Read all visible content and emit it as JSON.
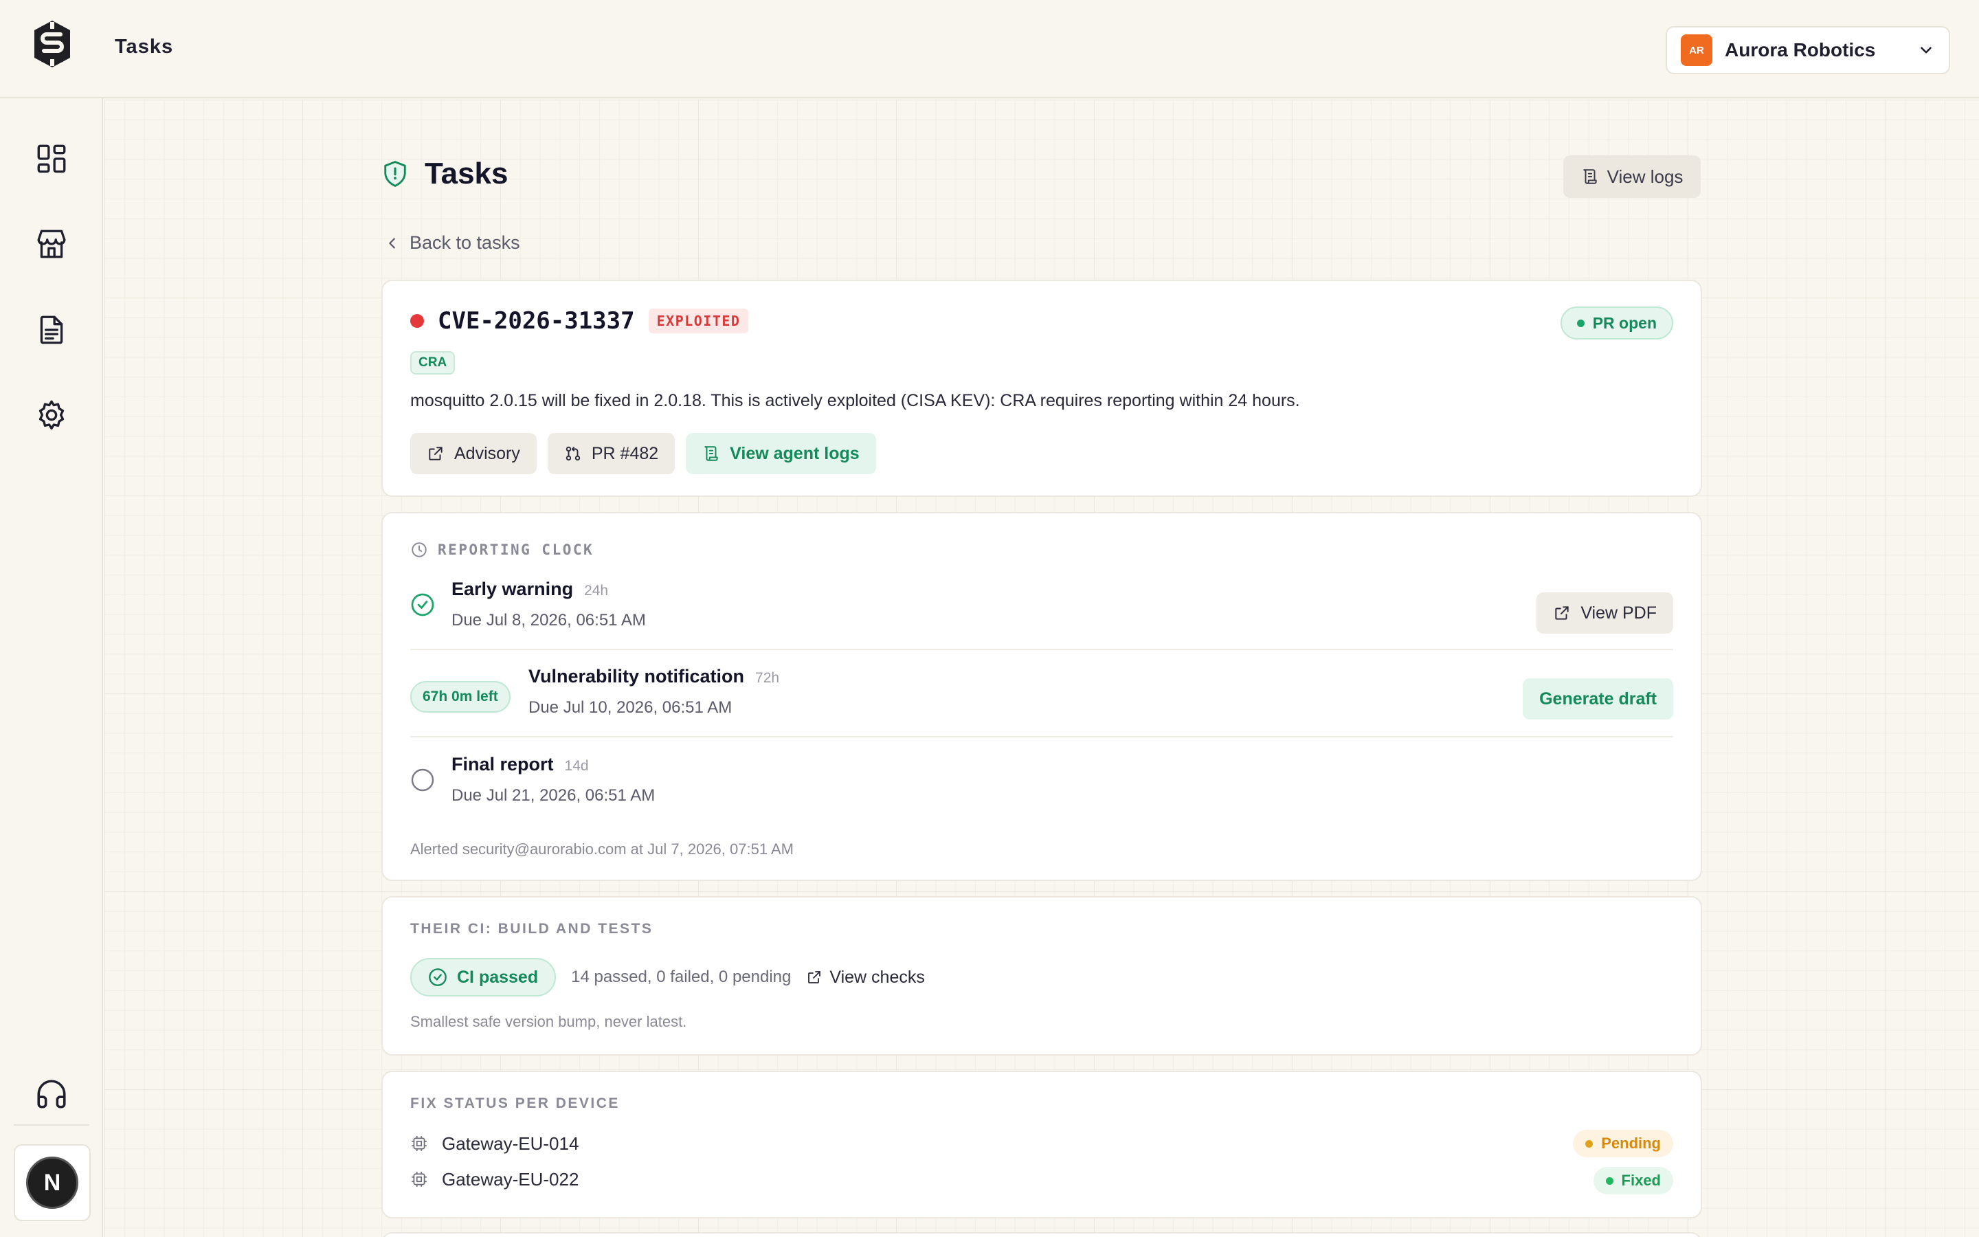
{
  "header": {
    "title": "Tasks",
    "org": {
      "initials": "AR",
      "name": "Aurora Robotics"
    }
  },
  "sidebar": {
    "items": [
      {
        "icon": "dashboard-icon"
      },
      {
        "icon": "store-icon"
      },
      {
        "icon": "document-icon"
      },
      {
        "icon": "gear-icon"
      }
    ],
    "support_icon": "headphones-icon",
    "user_initial": "N"
  },
  "page": {
    "title": "Tasks",
    "view_logs_label": "View logs",
    "back_label": "Back to tasks"
  },
  "vuln": {
    "id": "CVE-2026-31337",
    "exploited_badge": "EXPLOITED",
    "status": "PR open",
    "tag": "CRA",
    "description": "mosquitto 2.0.15 will be fixed in 2.0.18. This is actively exploited (CISA KEV): CRA requires reporting within 24 hours.",
    "actions": {
      "advisory": "Advisory",
      "pr": "PR #482",
      "agent_logs": "View agent logs"
    }
  },
  "reporting": {
    "label": "REPORTING CLOCK",
    "steps": [
      {
        "title": "Early warning",
        "hours": "24h",
        "due": "Due Jul 8, 2026, 06:51 AM",
        "action": "View PDF"
      },
      {
        "title": "Vulnerability notification",
        "hours": "72h",
        "due": "Due Jul 10, 2026, 06:51 AM",
        "time_left": "67h 0m left",
        "action": "Generate draft"
      },
      {
        "title": "Final report",
        "hours": "14d",
        "due": "Due Jul 21, 2026, 06:51 AM"
      }
    ],
    "alert_note": "Alerted security@aurorabio.com at Jul 7, 2026, 07:51 AM"
  },
  "ci": {
    "label": "THEIR CI: BUILD AND TESTS",
    "status": "CI passed",
    "counts": "14 passed, 0 failed, 0 pending",
    "view_checks": "View checks",
    "note": "Smallest safe version bump, never latest."
  },
  "devices": {
    "label": "FIX STATUS PER DEVICE",
    "items": [
      {
        "name": "Gateway-EU-014",
        "status": "Pending"
      },
      {
        "name": "Gateway-EU-022",
        "status": "Fixed"
      }
    ]
  },
  "colors": {
    "accent_green": "#148a5a",
    "danger_red": "#e5383b",
    "org_orange": "#f06a1f",
    "pending_amber": "#d68a0c"
  }
}
